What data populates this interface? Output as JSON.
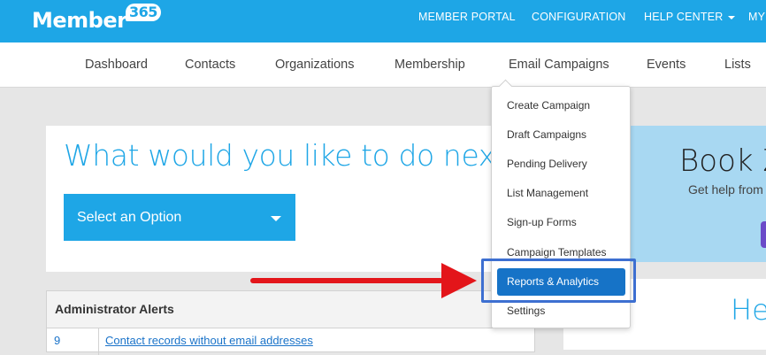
{
  "app": {
    "logo_text": "Member",
    "logo_number": "365"
  },
  "topnav": {
    "items": [
      "MEMBER PORTAL",
      "CONFIGURATION",
      "HELP CENTER",
      "MY"
    ]
  },
  "subnav": {
    "items": [
      "Dashboard",
      "Contacts",
      "Organizations",
      "Membership",
      "Email Campaigns",
      "Events",
      "Lists"
    ]
  },
  "main": {
    "heading": "What would you like to do next?",
    "select_label": "Select an Option"
  },
  "alerts": {
    "title": "Administrator Alerts",
    "rows": [
      {
        "count": "9",
        "text": "Contact records without email addresses"
      }
    ]
  },
  "right_panel": {
    "big_text": "Book Z",
    "small_text": "Get help from",
    "bottom_text": "He"
  },
  "dropdown": {
    "items": [
      "Create Campaign",
      "Draft Campaigns",
      "Pending Delivery",
      "List Management",
      "Sign-up Forms",
      "Campaign Templates",
      "Reports & Analytics",
      "Settings"
    ],
    "active_index": 6
  },
  "colors": {
    "brand": "#1ea6e6",
    "active_item": "#1673c7",
    "arrow": "#e3151a",
    "highlight_border": "#3d6fd1"
  }
}
